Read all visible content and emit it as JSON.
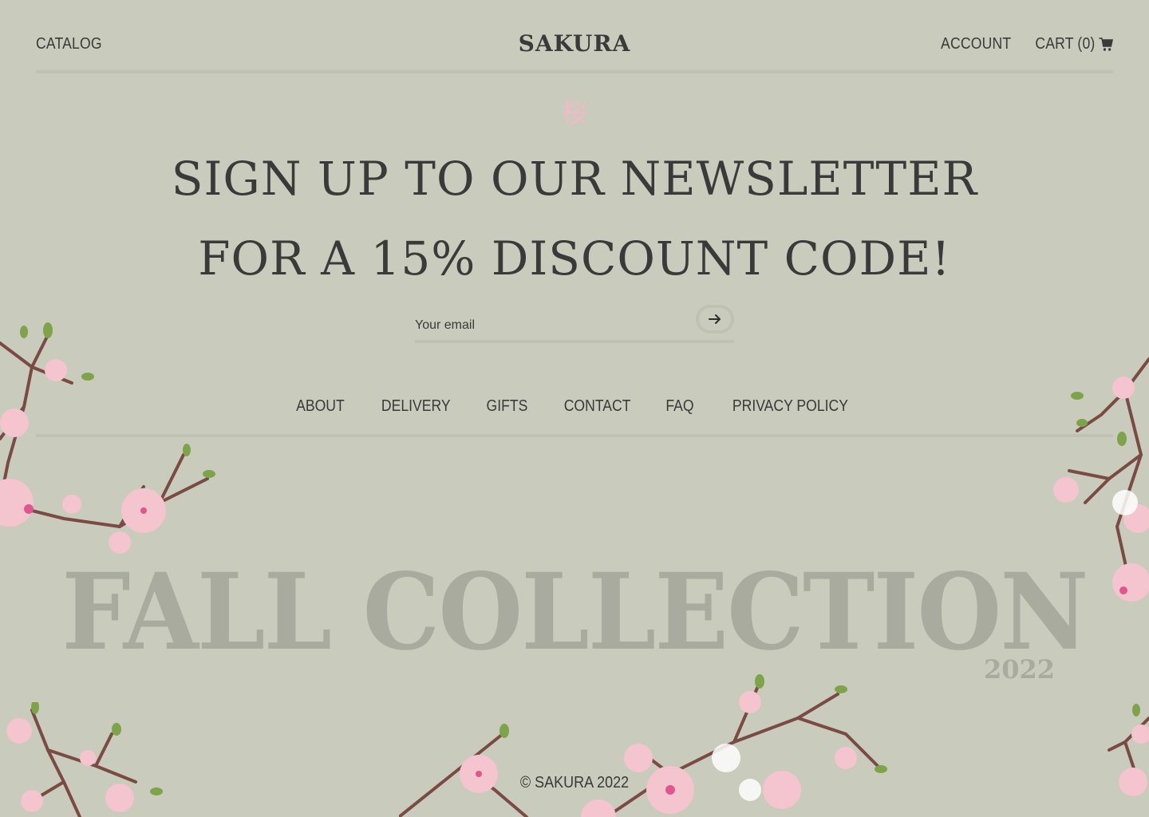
{
  "header": {
    "catalog_label": "CATALOG",
    "brand": "SAKURA",
    "account_label": "ACCOUNT",
    "cart_label": "CART (0)",
    "cart_icon": "shopping-cart-icon"
  },
  "newsletter": {
    "kanji": "桜",
    "headline_line1": "SIGN UP TO OUR NEWSLETTER",
    "headline_line2": "FOR A 15% DISCOUNT CODE!",
    "email_placeholder": "Your email",
    "submit_icon": "arrow-right-icon"
  },
  "footer_nav": {
    "items": [
      "ABOUT",
      "DELIVERY",
      "GIFTS",
      "CONTACT",
      "FAQ",
      "PRIVACY POLICY"
    ]
  },
  "promo": {
    "title": "FALL COLLECTION",
    "year": "2022"
  },
  "footer": {
    "copyright": "© SAKURA 2022"
  },
  "colors": {
    "background": "#c9cbbd",
    "text": "#3a3a3a",
    "divider": "#bfc1b3",
    "watermark": "#a9ab9f",
    "accent_pink": "#f2b9c7"
  }
}
